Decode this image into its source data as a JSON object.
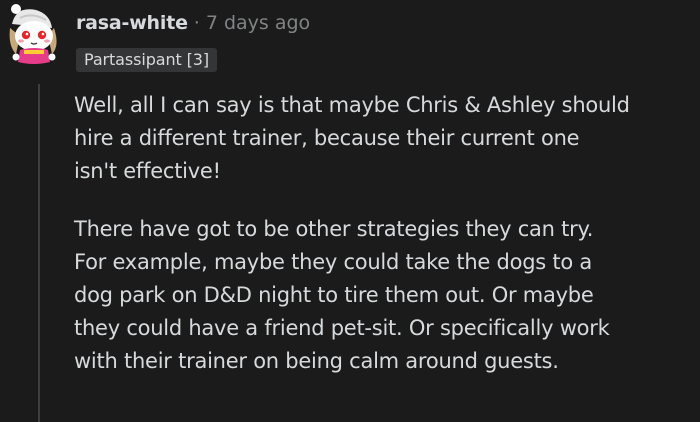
{
  "comment": {
    "author": "rasa-white",
    "separator": "·",
    "timestamp": "7 days ago",
    "flair": "Partassipant [3]",
    "paragraphs": [
      "Well, all I can say is that maybe Chris & Ashley should\nhire a different trainer, because their current one\nisn't effective!",
      "There have got to be other strategies they can try.\nFor example, maybe they could take the dogs to a\ndog park on D&D night to tire them out. Or maybe\nthey could have a friend pet-sit. Or specifically work\nwith their trainer on being calm around guests."
    ]
  },
  "colors": {
    "background": "#1b1b1b",
    "text": "#d7dadc",
    "muted": "#818384",
    "flair_bg": "#343536"
  }
}
